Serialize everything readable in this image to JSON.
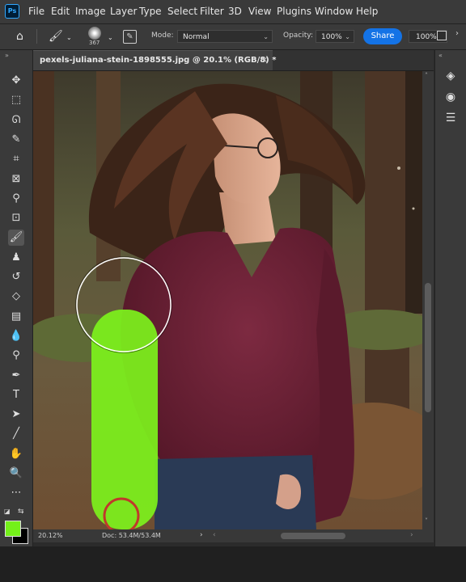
{
  "app": {
    "logo": "Ps"
  },
  "menu": [
    "File",
    "Edit",
    "Image",
    "Layer",
    "Type",
    "Select",
    "Filter",
    "3D",
    "View",
    "Plugins",
    "Window",
    "Help"
  ],
  "options": {
    "home_icon": "home-icon",
    "brush_size": "367",
    "mode_label": "Mode:",
    "mode_value": "Normal",
    "opacity_label": "Opacity:",
    "opacity_value": "100%",
    "share_label": "Share",
    "flow_value": "100%"
  },
  "document": {
    "tab_title": "pexels-juliana-stein-1898555.jpg @ 20.1% (RGB/8) *",
    "close": "×"
  },
  "status": {
    "zoom": "20.12%",
    "doc_info": "Doc: 53.4M/53.4M"
  },
  "colors": {
    "foreground": "#74f01a",
    "background": "#000000",
    "accent": "#1473e6",
    "sweater": "#6b1f34",
    "brush_stroke": "#7df21c"
  },
  "tools": [
    {
      "name": "move-tool-icon",
      "glyph": "✥"
    },
    {
      "name": "marquee-tool-icon",
      "glyph": "⬚"
    },
    {
      "name": "lasso-tool-icon",
      "glyph": "ᘏ"
    },
    {
      "name": "quick-select-tool-icon",
      "glyph": "✎"
    },
    {
      "name": "crop-tool-icon",
      "glyph": "⌗"
    },
    {
      "name": "frame-tool-icon",
      "glyph": "⊠"
    },
    {
      "name": "eyedropper-tool-icon",
      "glyph": "⚲"
    },
    {
      "name": "spot-healing-tool-icon",
      "glyph": "⊡"
    },
    {
      "name": "brush-tool-icon",
      "glyph": "🖌"
    },
    {
      "name": "stamp-tool-icon",
      "glyph": "♟"
    },
    {
      "name": "history-brush-tool-icon",
      "glyph": "↺"
    },
    {
      "name": "eraser-tool-icon",
      "glyph": "◇"
    },
    {
      "name": "gradient-tool-icon",
      "glyph": "▤"
    },
    {
      "name": "blur-tool-icon",
      "glyph": "💧"
    },
    {
      "name": "dodge-tool-icon",
      "glyph": "⚲"
    },
    {
      "name": "pen-tool-icon",
      "glyph": "✒"
    },
    {
      "name": "type-tool-icon",
      "glyph": "T"
    },
    {
      "name": "path-select-tool-icon",
      "glyph": "➤"
    },
    {
      "name": "line-tool-icon",
      "glyph": "╱"
    },
    {
      "name": "hand-tool-icon",
      "glyph": "✋"
    },
    {
      "name": "zoom-tool-icon",
      "glyph": "🔍"
    },
    {
      "name": "more-tools-icon",
      "glyph": "⋯"
    }
  ],
  "right_panel": [
    "layers-icon",
    "channels-icon",
    "adjustments-icon"
  ]
}
